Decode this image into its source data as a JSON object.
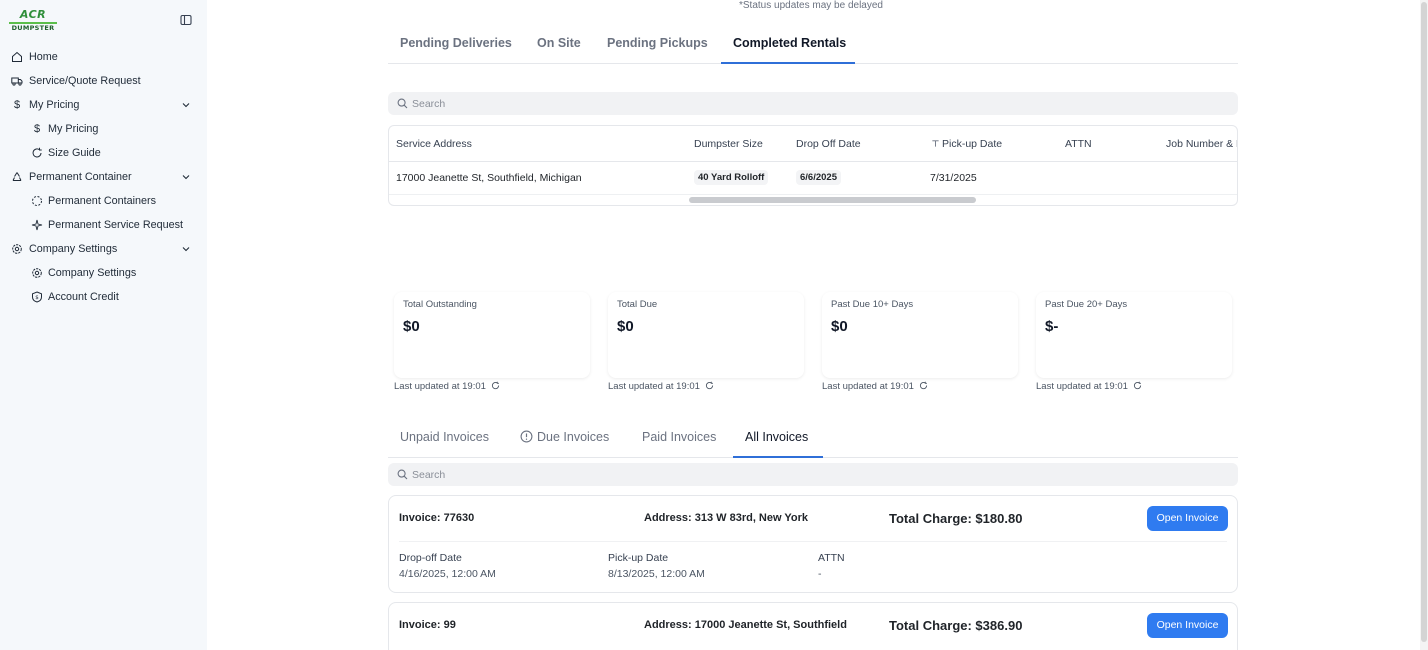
{
  "brand": {
    "line1": "ACR",
    "line2": "DUMPSTER"
  },
  "sidebar": {
    "items": [
      {
        "label": "Home",
        "icon": "home-icon"
      },
      {
        "label": "Service/Quote Request",
        "icon": "truck-icon"
      },
      {
        "label": "My Pricing",
        "icon": "dollar-icon"
      },
      {
        "label": "My Pricing",
        "icon": "dollar-icon"
      },
      {
        "label": "Size Guide",
        "icon": "refresh-icon"
      },
      {
        "label": "Permanent Container",
        "icon": "recycle-icon"
      },
      {
        "label": "Permanent Containers",
        "icon": "dashed-circle-icon"
      },
      {
        "label": "Permanent Service Request",
        "icon": "sparkle-icon"
      },
      {
        "label": "Company Settings",
        "icon": "gear-icon"
      },
      {
        "label": "Company Settings",
        "icon": "gear-icon"
      },
      {
        "label": "Account Credit",
        "icon": "shield-icon"
      }
    ]
  },
  "status_note": "*Status updates may be delayed",
  "rental_tabs": [
    "Pending Deliveries",
    "On Site",
    "Pending Pickups",
    "Completed Rentals"
  ],
  "rental_active_tab": "Completed Rentals",
  "rental_search": {
    "placeholder": "Search"
  },
  "rentals_table": {
    "columns": [
      "Service Address",
      "Dumpster Size",
      "Drop Off Date",
      "Pick-up Date",
      "ATTN",
      "Job Number & N"
    ],
    "rows": [
      {
        "address": "17000 Jeanette St, Southfield, Michigan",
        "size": "40 Yard Rolloff",
        "dropoff": "6/6/2025",
        "pickup": "7/31/2025",
        "attn": "",
        "job": ""
      }
    ]
  },
  "summary_cards": [
    {
      "title": "Total Outstanding",
      "value": "$0",
      "updated": "Last updated at 19:01"
    },
    {
      "title": "Total Due",
      "value": "$0",
      "updated": "Last updated at 19:01"
    },
    {
      "title": "Past Due 10+ Days",
      "value": "$0",
      "updated": "Last updated at 19:01"
    },
    {
      "title": "Past Due 20+ Days",
      "value": "$-",
      "updated": "Last updated at 19:01"
    }
  ],
  "invoice_tabs": [
    "Unpaid Invoices",
    "Due Invoices",
    "Paid Invoices",
    "All Invoices"
  ],
  "invoice_active_tab": "All Invoices",
  "invoice_search": {
    "placeholder": "Search"
  },
  "invoices": [
    {
      "number": "Invoice: 77630",
      "address": "Address: 313 W 83rd, New York",
      "charge": "Total Charge: $180.80",
      "button": "Open Invoice",
      "dropoff_label": "Drop-off Date",
      "dropoff_value": "4/16/2025, 12:00 AM",
      "pickup_label": "Pick-up Date",
      "pickup_value": "8/13/2025, 12:00 AM",
      "attn_label": "ATTN",
      "attn_value": "-"
    },
    {
      "number": "Invoice: 99",
      "address": "Address: 17000 Jeanette St, Southfield",
      "charge": "Total Charge: $386.90",
      "button": "Open Invoice"
    }
  ],
  "colors": {
    "accent": "#2f7bf0",
    "tab_underline": "#2f6fd8",
    "sidebar_bg": "#f5f8fb",
    "brand_green": "#2f8f3a"
  }
}
